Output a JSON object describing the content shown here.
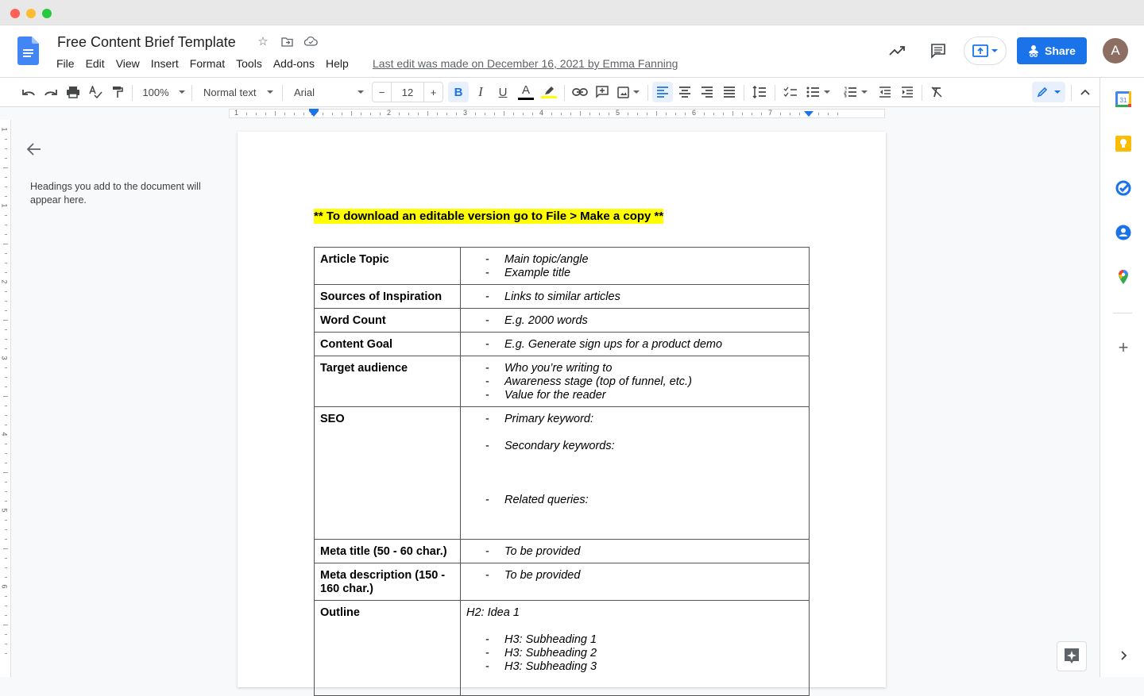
{
  "window": {
    "traffic_lights": {
      "close": "#ff5f57",
      "minimize": "#febc2e",
      "maximize": "#28c840"
    }
  },
  "header": {
    "title": "Free Content Brief Template",
    "title_icons": [
      "star-icon",
      "move-to-folder-icon",
      "cloud-saved-icon"
    ],
    "menu": [
      "File",
      "Edit",
      "View",
      "Insert",
      "Format",
      "Tools",
      "Add-ons",
      "Help"
    ],
    "last_edit": "Last edit was made on December 16, 2021 by Emma Fanning",
    "share_label": "Share",
    "avatar_initial": "A",
    "brand_color": "#1a73e8"
  },
  "toolbar": {
    "zoom": "100%",
    "style": "Normal text",
    "font": "Arial",
    "font_size": "12",
    "decrease": "−",
    "increase": "+",
    "bold_active": true,
    "alignment": "left",
    "text_color": "#000000",
    "highlight_color": "#ffff00"
  },
  "ruler": {
    "labels": [
      "1",
      "1",
      "2",
      "3",
      "4",
      "5",
      "6",
      "7"
    ],
    "vertical_labels": [
      "1",
      "1",
      "2",
      "3",
      "4",
      "5",
      "6"
    ]
  },
  "outline": {
    "hint": "Headings you add to the document will appear here."
  },
  "document": {
    "banner": "** To download an editable version go to File > Make a copy **",
    "rows": [
      {
        "label": "Article Topic",
        "items": [
          "Main topic/angle",
          "Example title"
        ]
      },
      {
        "label": "Sources of Inspiration",
        "items": [
          "Links to similar articles"
        ]
      },
      {
        "label": "Word Count",
        "items": [
          "E.g. 2000 words"
        ]
      },
      {
        "label": "Content Goal",
        "items": [
          "E.g. Generate sign ups for a product demo"
        ]
      },
      {
        "label": "Target audience",
        "items": [
          "Who you’re writing to",
          "Awareness stage (top of funnel, etc.)",
          "Value for the reader"
        ]
      },
      {
        "label": "SEO",
        "items": [
          "Primary keyword:",
          "Secondary keywords:",
          "Related queries:"
        ]
      },
      {
        "label": "Meta title (50 - 60 char.)",
        "items": [
          "To be provided"
        ]
      },
      {
        "label": "Meta description (150 - 160 char.)",
        "items": [
          "To be provided"
        ]
      },
      {
        "label": "Outline",
        "heading": "H2: Idea 1",
        "items": [
          "H3: Subheading 1",
          "H3: Subheading 2",
          "H3: Subheading 3"
        ]
      }
    ]
  },
  "side_panel": {
    "apps": [
      "calendar-icon",
      "keep-icon",
      "tasks-icon",
      "contacts-icon",
      "maps-icon"
    ],
    "add_label": "+"
  }
}
